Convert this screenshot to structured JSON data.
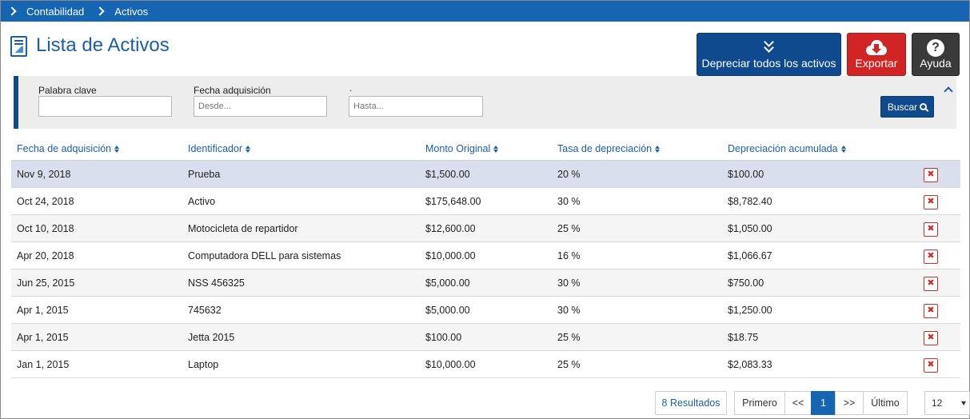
{
  "breadcrumb": [
    "Contabilidad",
    "Activos"
  ],
  "page": {
    "title": "Lista de Activos"
  },
  "actions": {
    "depreciar_label": "Depreciar todos los activos",
    "exportar_label": "Exportar",
    "ayuda_label": "Ayuda"
  },
  "filters": {
    "keyword_label": "Palabra clave",
    "keyword_value": "",
    "date_label": "Fecha adquisición",
    "date_from_placeholder": "Desde...",
    "date_to_label": ".",
    "date_to_placeholder": "Hasta...",
    "search_label": "Buscar"
  },
  "table": {
    "columns": [
      "Fecha de adquisición",
      "Identificador",
      "Monto Original",
      "Tasa de depreciación",
      "Depreciación acumulada"
    ],
    "rows": [
      [
        "Nov 9, 2018",
        "Prueba",
        "$1,500.00",
        "20 %",
        "$100.00"
      ],
      [
        "Oct 24, 2018",
        "Activo",
        "$175,648.00",
        "30 %",
        "$8,782.40"
      ],
      [
        "Oct 10, 2018",
        "Motocicleta de repartidor",
        "$12,600.00",
        "25 %",
        "$1,050.00"
      ],
      [
        "Apr 20, 2018",
        "Computadora DELL para sistemas",
        "$10,000.00",
        "16 %",
        "$1,066.67"
      ],
      [
        "Jun 25, 2015",
        "NSS 456325",
        "$5,000.00",
        "30 %",
        "$750.00"
      ],
      [
        "Apr 1, 2015",
        "745632",
        "$5,000.00",
        "30 %",
        "$1,250.00"
      ],
      [
        "Apr 1, 2015",
        "Jetta 2015",
        "$100.00",
        "25 %",
        "$18.75"
      ],
      [
        "Jan 1, 2015",
        "Laptop",
        "$10,000.00",
        "25 %",
        "$2,083.33"
      ]
    ],
    "delete_glyph": "✖"
  },
  "pagination": {
    "results": "8 Resultados",
    "first": "Primero",
    "prev": "<<",
    "current": "1",
    "next": ">>",
    "last": "Último",
    "page_size": "12"
  },
  "colors": {
    "primary": "#1565b3",
    "dark_blue": "#104a8e",
    "export_red": "#d12525",
    "help_gray": "#3a3a3a",
    "selected_row": "#dadfee"
  }
}
